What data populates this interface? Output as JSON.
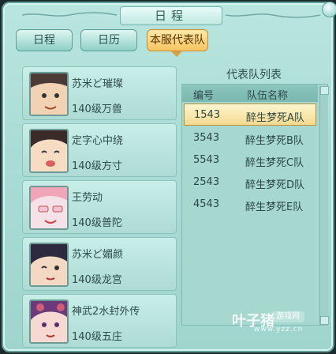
{
  "window": {
    "title": "日程"
  },
  "tabs": [
    {
      "label": "日程",
      "active": false
    },
    {
      "label": "日历",
      "active": false
    },
    {
      "label": "本服代表队",
      "active": true
    }
  ],
  "members": [
    {
      "name": "苏米ど璀璨",
      "level": "140级万兽",
      "avatar_icon": "female-character-portrait"
    },
    {
      "name": "定字心中绕",
      "level": "140级方寸",
      "avatar_icon": "female-character-portrait"
    },
    {
      "name": "王劳动",
      "level": "140级普陀",
      "avatar_icon": "female-character-portrait"
    },
    {
      "name": "苏米ど媚颜",
      "level": "140级龙宫",
      "avatar_icon": "female-character-portrait"
    },
    {
      "name": "神武2水封外传",
      "level": "140级五庄",
      "avatar_icon": "female-character-portrait"
    }
  ],
  "roster": {
    "title": "代表队列表",
    "headers": {
      "number": "编号",
      "name": "队伍名称"
    },
    "rows": [
      {
        "number": "1543",
        "name": "醉生梦死A队",
        "selected": true
      },
      {
        "number": "3543",
        "name": "醉生梦死B队",
        "selected": false
      },
      {
        "number": "5543",
        "name": "醉生梦死C队",
        "selected": false
      },
      {
        "number": "2543",
        "name": "醉生梦死D队",
        "selected": false
      },
      {
        "number": "4543",
        "name": "醉生梦死E队",
        "selected": false
      }
    ]
  },
  "watermark": {
    "text": "叶子猪",
    "badge": "游戏网",
    "url": "www.yzz.cn"
  },
  "colors": {
    "panel": "#a9dcd4",
    "accent": "#f6c463",
    "border": "#5f9f98"
  }
}
